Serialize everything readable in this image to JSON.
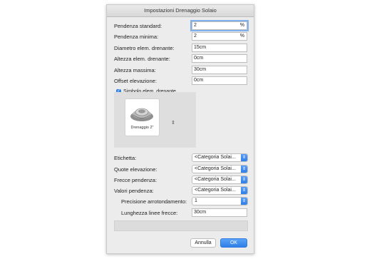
{
  "dialog": {
    "title": "Impostazioni Drenaggio Solaio"
  },
  "fields": [
    {
      "label": "Pendenza standard:",
      "value": "2",
      "unit": "%"
    },
    {
      "label": "Pendenza minima:",
      "value": "2",
      "unit": "%"
    },
    {
      "label": "Diametro elem. drenante:",
      "value": "15cm",
      "unit": ""
    },
    {
      "label": "Altezza elem. drenante:",
      "value": "0cm",
      "unit": ""
    },
    {
      "label": "Altezza massima:",
      "value": "30cm",
      "unit": ""
    },
    {
      "label": "Offset elevazione:",
      "value": "0cm",
      "unit": ""
    }
  ],
  "symbol": {
    "checkbox_label": "Simbolo elem. drenante",
    "checked": true,
    "tile_caption": "Drenaggio 2\""
  },
  "selects": [
    {
      "label": "Etichetta:",
      "value": "<Categoria Solai..."
    },
    {
      "label": "Quote elevazione:",
      "value": "<Categoria Solai..."
    },
    {
      "label": "Frecce pendenza:",
      "value": "<Categoria Solai..."
    },
    {
      "label": "Valori pendenza:",
      "value": "<Categoria Solai..."
    }
  ],
  "rounding": {
    "label": "Precisione arrotondamento:",
    "value": "1"
  },
  "arrow_length": {
    "label": "Lunghezza linee frecce:",
    "value": "30cm"
  },
  "buttons": {
    "cancel": "Annulla",
    "ok": "OK"
  },
  "colors": {
    "accent": "#2f7fe7",
    "background": "#ececec"
  }
}
